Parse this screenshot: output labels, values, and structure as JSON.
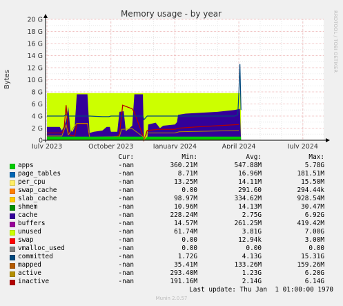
{
  "chart_data": {
    "type": "area",
    "title": "Memory usage - by year",
    "ylabel": "Bytes",
    "side_label": "RRDTOOL / TOBI OETIKER",
    "ylim": [
      0,
      20
    ],
    "y_unit": "G",
    "y_ticks": [
      "0",
      "2 G",
      "4 G",
      "6 G",
      "8 G",
      "10 G",
      "12 G",
      "14 G",
      "16 G",
      "18 G",
      "20 G"
    ],
    "x_ticks": [
      "July 2023",
      "October 2023",
      "January 2024",
      "April 2024",
      "July 2024"
    ],
    "grid": true,
    "series": [
      {
        "name": "apps",
        "color": "#00cc00"
      },
      {
        "name": "page_tables",
        "color": "#0066b3"
      },
      {
        "name": "per_cpu",
        "color": "#ff8000"
      },
      {
        "name": "swap_cache",
        "color": "#ffcc00"
      },
      {
        "name": "slab_cache",
        "color": "#330099"
      },
      {
        "name": "shmem",
        "color": "#990099"
      },
      {
        "name": "cache",
        "color": "#ccff00"
      },
      {
        "name": "buffers",
        "color": "#ff0000"
      },
      {
        "name": "unused",
        "color": "#808080"
      },
      {
        "name": "swap",
        "color": "#008f00"
      },
      {
        "name": "vmalloc_used",
        "color": "#00487d"
      },
      {
        "name": "committed",
        "color": "#b35a00"
      },
      {
        "name": "mapped",
        "color": "#b38f00"
      },
      {
        "name": "active",
        "color": "#6b006b"
      },
      {
        "name": "inactive",
        "color": "#8fb300"
      }
    ]
  },
  "legend": {
    "headers": {
      "cur": "Cur:",
      "min": "Min:",
      "avg": "Avg:",
      "max": "Max:"
    },
    "rows": [
      {
        "name": "apps",
        "color": "#00cc00",
        "cur": "-nan",
        "min": "360.21M",
        "avg": "547.88M",
        "max": "5.78G"
      },
      {
        "name": "page_tables",
        "color": "#0066b3",
        "cur": "-nan",
        "min": "8.71M",
        "avg": "16.96M",
        "max": "181.51M"
      },
      {
        "name": "per_cpu",
        "color": "#ffee66",
        "cur": "-nan",
        "min": "13.25M",
        "avg": "14.11M",
        "max": "15.50M"
      },
      {
        "name": "swap_cache",
        "color": "#ff8000",
        "cur": "-nan",
        "min": "0.00",
        "avg": "291.60",
        "max": "294.44k"
      },
      {
        "name": "slab_cache",
        "color": "#ffcc00",
        "cur": "-nan",
        "min": "98.97M",
        "avg": "334.62M",
        "max": "928.54M"
      },
      {
        "name": "shmem",
        "color": "#008f00",
        "cur": "-nan",
        "min": "10.96M",
        "avg": "14.13M",
        "max": "30.47M"
      },
      {
        "name": "cache",
        "color": "#330099",
        "cur": "-nan",
        "min": "228.24M",
        "avg": "2.75G",
        "max": "6.92G"
      },
      {
        "name": "buffers",
        "color": "#990099",
        "cur": "-nan",
        "min": "14.57M",
        "avg": "261.25M",
        "max": "419.42M"
      },
      {
        "name": "unused",
        "color": "#ccff00",
        "cur": "-nan",
        "min": "61.74M",
        "avg": "3.81G",
        "max": "7.00G"
      },
      {
        "name": "swap",
        "color": "#ff0000",
        "cur": "-nan",
        "min": "0.00",
        "avg": "12.94k",
        "max": "3.00M"
      },
      {
        "name": "vmalloc_used",
        "color": "#808080",
        "cur": "-nan",
        "min": "0.00",
        "avg": "0.00",
        "max": "0.00"
      },
      {
        "name": "committed",
        "color": "#00487d",
        "cur": "-nan",
        "min": "1.72G",
        "avg": "4.13G",
        "max": "15.31G"
      },
      {
        "name": "mapped",
        "color": "#b35a00",
        "cur": "-nan",
        "min": "35.41M",
        "avg": "133.26M",
        "max": "159.26M"
      },
      {
        "name": "active",
        "color": "#b38f00",
        "cur": "-nan",
        "min": "293.40M",
        "avg": "1.23G",
        "max": "6.20G"
      },
      {
        "name": "inactive",
        "color": "#b30000",
        "cur": "-nan",
        "min": "191.16M",
        "avg": "2.14G",
        "max": "6.14G"
      }
    ]
  },
  "footer": {
    "last_update": "Last update: Thu Jan  1 01:00:00 1970",
    "generator": "Munin 2.0.57"
  }
}
